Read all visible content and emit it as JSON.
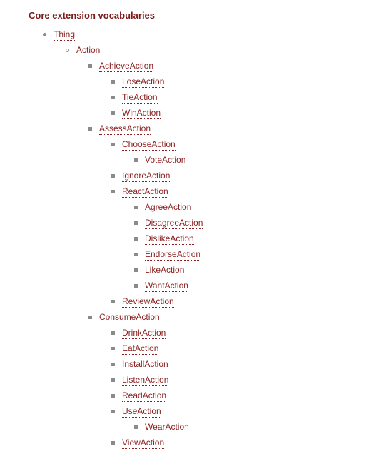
{
  "heading": "Core extension vocabularies",
  "tree": [
    {
      "label": "Thing",
      "children": [
        {
          "label": "Action",
          "children": [
            {
              "label": "AchieveAction",
              "children": [
                {
                  "label": "LoseAction"
                },
                {
                  "label": "TieAction"
                },
                {
                  "label": "WinAction"
                }
              ]
            },
            {
              "label": "AssessAction",
              "children": [
                {
                  "label": "ChooseAction",
                  "children": [
                    {
                      "label": "VoteAction"
                    }
                  ]
                },
                {
                  "label": "IgnoreAction"
                },
                {
                  "label": "ReactAction",
                  "children": [
                    {
                      "label": "AgreeAction"
                    },
                    {
                      "label": "DisagreeAction"
                    },
                    {
                      "label": "DislikeAction"
                    },
                    {
                      "label": "EndorseAction"
                    },
                    {
                      "label": "LikeAction"
                    },
                    {
                      "label": "WantAction"
                    }
                  ]
                },
                {
                  "label": "ReviewAction"
                }
              ]
            },
            {
              "label": "ConsumeAction",
              "children": [
                {
                  "label": "DrinkAction"
                },
                {
                  "label": "EatAction"
                },
                {
                  "label": "InstallAction"
                },
                {
                  "label": "ListenAction"
                },
                {
                  "label": "ReadAction"
                },
                {
                  "label": "UseAction",
                  "children": [
                    {
                      "label": "WearAction"
                    }
                  ]
                },
                {
                  "label": "ViewAction"
                }
              ]
            }
          ]
        }
      ]
    }
  ]
}
